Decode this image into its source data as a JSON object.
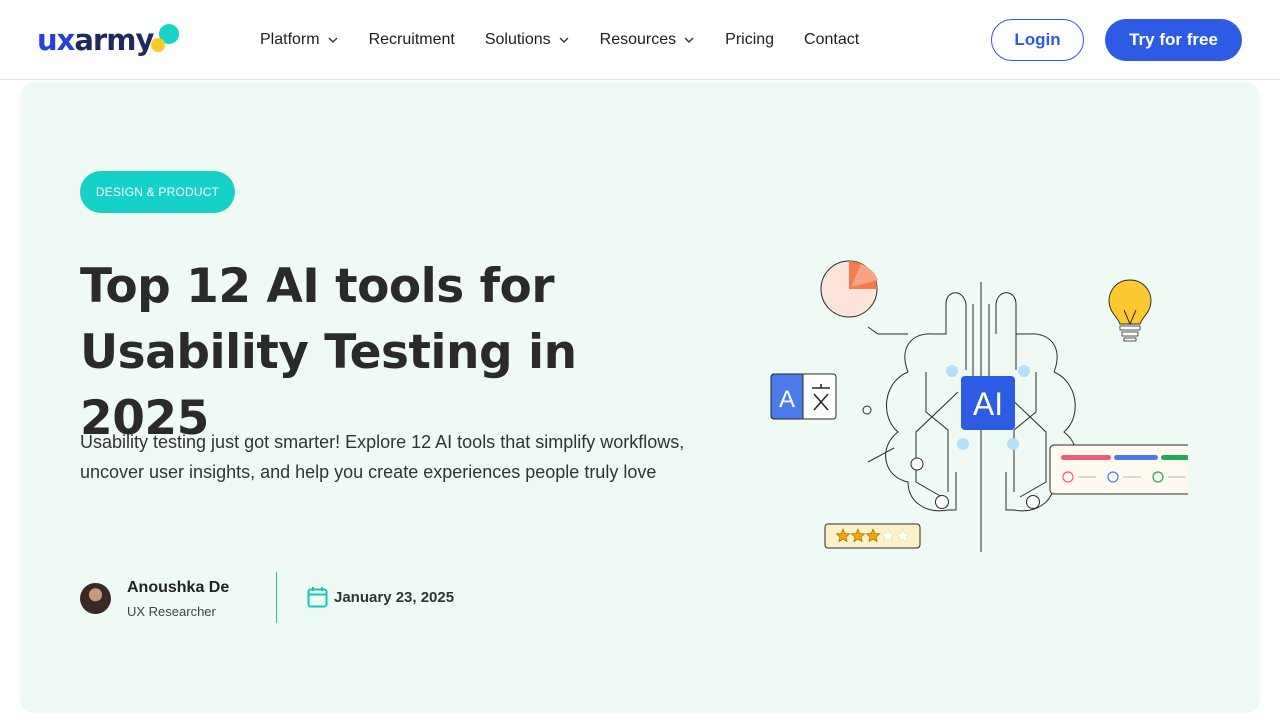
{
  "header": {
    "logo_ux": "ux",
    "logo_army": "army",
    "nav": [
      {
        "label": "Platform",
        "dropdown": true
      },
      {
        "label": "Recruitment",
        "dropdown": false
      },
      {
        "label": "Solutions",
        "dropdown": true
      },
      {
        "label": "Resources",
        "dropdown": true
      },
      {
        "label": "Pricing",
        "dropdown": false
      },
      {
        "label": "Contact",
        "dropdown": false
      }
    ],
    "login_label": "Login",
    "try_label": "Try for free"
  },
  "hero": {
    "badge": "DESIGN & PRODUCT",
    "title": "Top 12 AI tools for Usability Testing in 2025",
    "subtitle": "Usability testing just got smarter! Explore 12 AI tools that simplify workflows, uncover user insights, and help you create experiences people truly love",
    "author_name": "Anoushka De",
    "author_role": "UX Researcher",
    "date": "January 23, 2025",
    "illustration": {
      "center_label": "AI",
      "translate_glyph": "A",
      "rating_stars": 3,
      "rating_max": 5
    }
  },
  "colors": {
    "brand_blue": "#2d5be3",
    "teal": "#16d1c7",
    "hero_bg": "#eefaf3"
  }
}
